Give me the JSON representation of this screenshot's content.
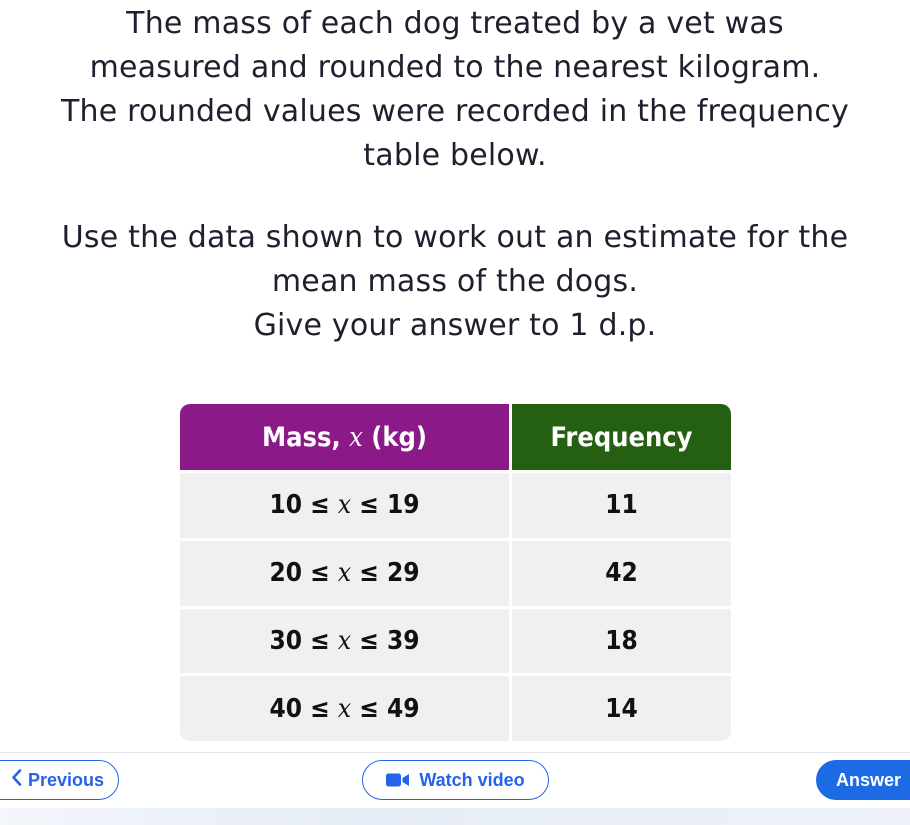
{
  "question": {
    "lines_para1": [
      "The mass of each dog treated by a vet was",
      "measured and rounded to the nearest kilogram.",
      "The rounded values were recorded in the frequency",
      "table below."
    ],
    "lines_para2": [
      "Use the data shown to work out an estimate for the",
      "mean mass of the dogs.",
      "Give your answer to 1 d.p."
    ]
  },
  "table": {
    "header_mass_prefix": "Mass, ",
    "header_mass_var": "x",
    "header_mass_suffix": " (kg)",
    "header_frequency": "Frequency",
    "var": "x",
    "rows": [
      {
        "low": "10 ≤ ",
        "high": " ≤ 19",
        "frequency": "11"
      },
      {
        "low": "20 ≤ ",
        "high": " ≤ 29",
        "frequency": "42"
      },
      {
        "low": "30 ≤ ",
        "high": " ≤ 39",
        "frequency": "18"
      },
      {
        "low": "40 ≤ ",
        "high": " ≤ 49",
        "frequency": "14"
      }
    ],
    "colors": {
      "mass_header": "#8b1a88",
      "frequency_header": "#256012",
      "cell_background": "#f0f0f0"
    }
  },
  "footer": {
    "previous_label": "Previous",
    "watch_video_label": "Watch video",
    "answer_label": "Answer",
    "icons": {
      "previous": "chevron-left-icon",
      "video": "video-camera-icon"
    },
    "accent_color": "#2563eb"
  }
}
